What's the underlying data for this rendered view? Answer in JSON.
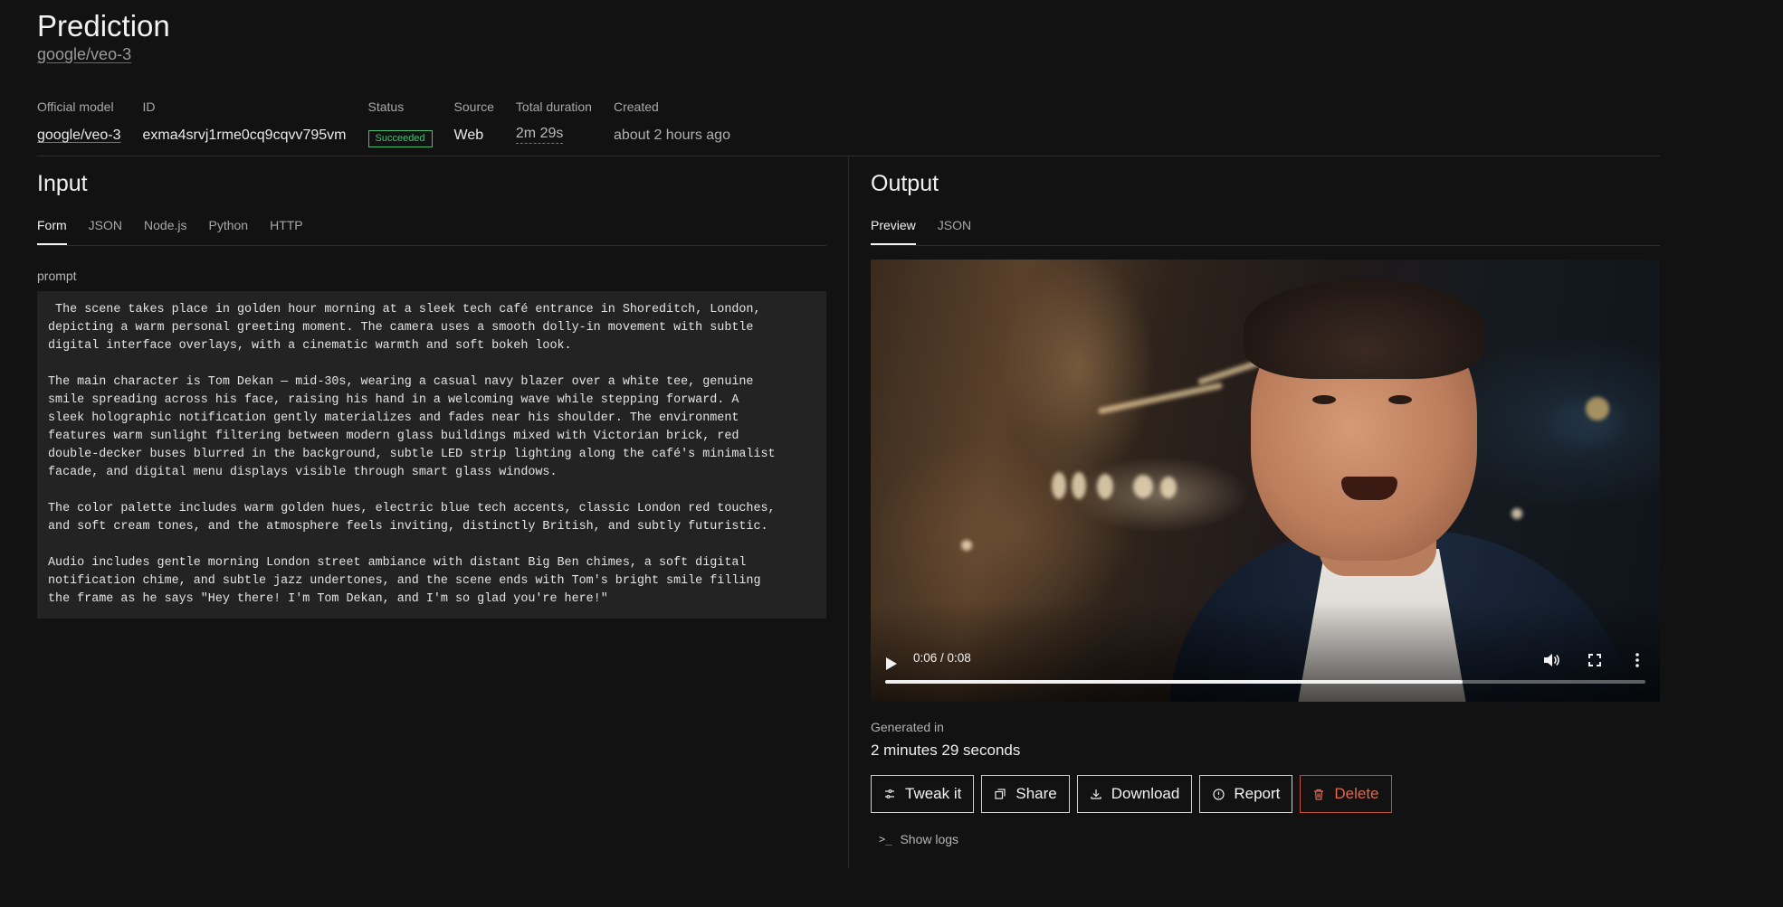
{
  "header": {
    "title": "Prediction",
    "model_link": "google/veo-3"
  },
  "meta": {
    "official_model": {
      "label": "Official model",
      "value": "google/veo-3"
    },
    "id": {
      "label": "ID",
      "value": "exma4srvj1rme0cq9cqvv795vm"
    },
    "status": {
      "label": "Status",
      "value": "Succeeded"
    },
    "source": {
      "label": "Source",
      "value": "Web"
    },
    "total_duration": {
      "label": "Total duration",
      "value": "2m 29s"
    },
    "created": {
      "label": "Created",
      "value": "about 2 hours ago"
    }
  },
  "input": {
    "title": "Input",
    "tabs": [
      "Form",
      "JSON",
      "Node.js",
      "Python",
      "HTTP"
    ],
    "active_tab": "Form",
    "prompt_label": "prompt",
    "prompt_text": " The scene takes place in golden hour morning at a sleek tech café entrance in Shoreditch, London,\ndepicting a warm personal greeting moment. The camera uses a smooth dolly-in movement with subtle\ndigital interface overlays, with a cinematic warmth and soft bokeh look.\n\nThe main character is Tom Dekan — mid-30s, wearing a casual navy blazer over a white tee, genuine\nsmile spreading across his face, raising his hand in a welcoming wave while stepping forward. A\nsleek holographic notification gently materializes and fades near his shoulder. The environment\nfeatures warm sunlight filtering between modern glass buildings mixed with Victorian brick, red\ndouble-decker buses blurred in the background, subtle LED strip lighting along the café's minimalist\nfacade, and digital menu displays visible through smart glass windows.\n\nThe color palette includes warm golden hues, electric blue tech accents, classic London red touches,\nand soft cream tones, and the atmosphere feels inviting, distinctly British, and subtly futuristic.\n\nAudio includes gentle morning London street ambiance with distant Big Ben chimes, a soft digital\nnotification chime, and subtle jazz undertones, and the scene ends with Tom's bright smile filling\nthe frame as he says \"Hey there! I'm Tom Dekan, and I'm so glad you're here!\""
  },
  "output": {
    "title": "Output",
    "tabs": [
      "Preview",
      "JSON"
    ],
    "active_tab": "Preview",
    "video": {
      "time_display": "0:06 / 0:08",
      "progress_fraction": 0.76,
      "icons": [
        "play-icon",
        "volume-icon",
        "fullscreen-icon",
        "more-options-icon"
      ]
    },
    "generated_label": "Generated in",
    "generated_value": "2 minutes 29 seconds",
    "buttons": {
      "tweak": "Tweak it",
      "share": "Share",
      "download": "Download",
      "report": "Report",
      "delete": "Delete"
    },
    "show_logs": "Show logs"
  },
  "colors": {
    "background": "#121212",
    "success": "#4bbd76",
    "danger": "#e0684f",
    "prompt_background": "#232323"
  }
}
